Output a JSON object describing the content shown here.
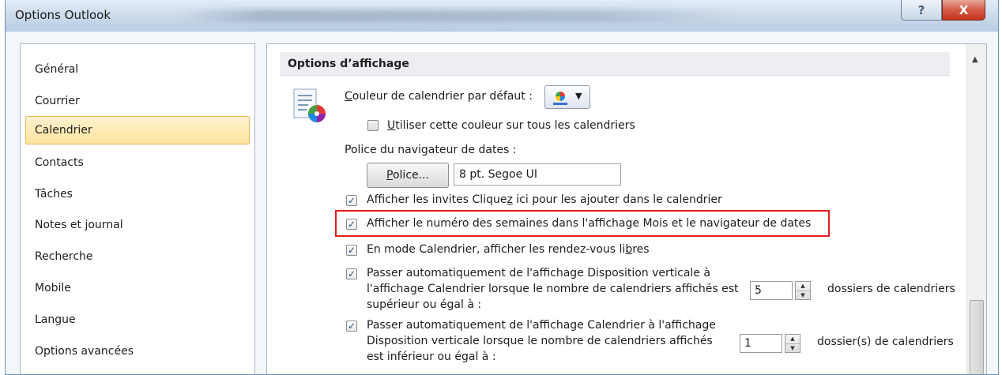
{
  "window": {
    "title": "Options Outlook",
    "help_glyph": "?",
    "close_glyph": "X"
  },
  "sidebar": {
    "items": [
      {
        "label": "Général",
        "selected": false
      },
      {
        "label": "Courrier",
        "selected": false
      },
      {
        "label": "Calendrier",
        "selected": true
      },
      {
        "label": "Contacts",
        "selected": false
      },
      {
        "label": "Tâches",
        "selected": false
      },
      {
        "label": "Notes et journal",
        "selected": false
      },
      {
        "label": "Recherche",
        "selected": false
      },
      {
        "label": "Mobile",
        "selected": false
      },
      {
        "label": "Langue",
        "selected": false
      },
      {
        "label": "Options avancées",
        "selected": false
      }
    ]
  },
  "main": {
    "section_title": "Options d’affichage",
    "default_color": {
      "label_prefix": "C",
      "label_rest": "ouleur de calendrier par défaut :"
    },
    "use_color_all": {
      "checked": false,
      "label_prefix": "U",
      "label_rest": "tiliser cette couleur sur tous les calendriers"
    },
    "date_nav_font": {
      "label": "Police du navigateur de dates :",
      "button_prefix": "P",
      "button_rest": "olice...",
      "value": "8 pt. Segoe UI"
    },
    "show_invites": {
      "checked": true,
      "label_a": "Afficher les invites Clique",
      "label_u": "z",
      "label_b": " ici pour les ajouter dans le calendrier"
    },
    "show_week_numbers": {
      "checked": true,
      "label": "Afficher le numéro des semaines dans l'affichage Mois et le navigateur de dates"
    },
    "free_appointments": {
      "checked": true,
      "label_a": "En mode Calendrier, afficher les rendez-vous li",
      "label_u": "b",
      "label_b": "res"
    },
    "auto_switch_schedule": {
      "checked": true,
      "line1": "Passer automatiquement de l'affichage Disposition verticale à",
      "line2": "l'affichage Calendrier lorsque le nombre de calendriers affichés est",
      "line3": "supérieur ou égal à :",
      "value": "5",
      "suffix": "dossiers de calendriers"
    },
    "auto_switch_calendar": {
      "checked": true,
      "line1": "Passer automatiquement de l'affichage Calendrier à l'affichage",
      "line2": "Disposition verticale lorsque le nombre de calendriers affichés",
      "line3": "est inférieur ou égal à :",
      "value": "1",
      "suffix": "dossier(s) de calendriers"
    }
  },
  "colors": {
    "selected_bg": "#fde39e",
    "highlight_border": "#e01e1e",
    "close_button": "#d45b45"
  }
}
